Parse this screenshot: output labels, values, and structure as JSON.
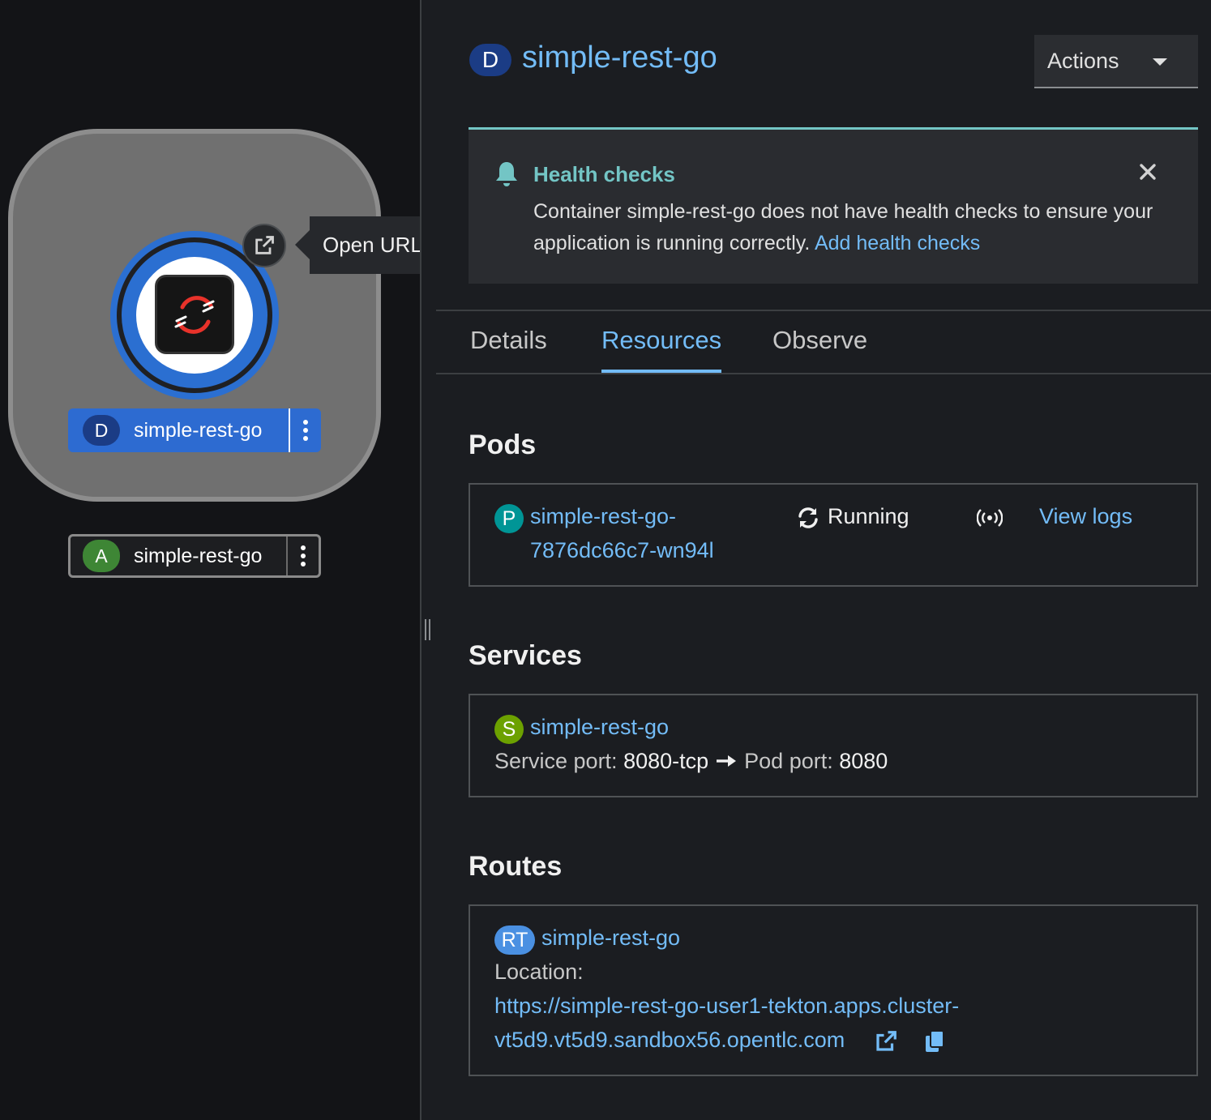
{
  "topology": {
    "tooltip": "Open URL",
    "deployment_label": {
      "badge": "D",
      "name": "simple-rest-go"
    },
    "application_label": {
      "badge": "A",
      "name": "simple-rest-go"
    }
  },
  "panel": {
    "title_badge": "D",
    "title": "simple-rest-go",
    "actions_label": "Actions",
    "alert": {
      "title": "Health checks",
      "message": "Container simple-rest-go does not have health checks to ensure your application is running correctly.",
      "link": "Add health checks"
    },
    "tabs": [
      {
        "label": "Details",
        "active": false
      },
      {
        "label": "Resources",
        "active": true
      },
      {
        "label": "Observe",
        "active": false
      }
    ],
    "pods": {
      "title": "Pods",
      "badge": "P",
      "name_line1": "simple-rest-go-",
      "name_line2": "7876dc66c7-wn94l",
      "status": "Running",
      "view_logs": "View logs"
    },
    "services": {
      "title": "Services",
      "badge": "S",
      "name": "simple-rest-go",
      "service_port_label": "Service port:",
      "service_port": "8080-tcp",
      "pod_port_label": "Pod port:",
      "pod_port": "8080"
    },
    "routes": {
      "title": "Routes",
      "badge": "RT",
      "name": "simple-rest-go",
      "location_label": "Location:",
      "url_line1": "https://simple-rest-go-user1-tekton.apps.cluster-",
      "url_line2": "vt5d9.vt5d9.sandbox56.opentlc.com"
    }
  },
  "colors": {
    "link": "#73bcf7",
    "deployment_badge": "#1b3c85",
    "application_badge": "#3e8635",
    "pod_badge": "#009596",
    "service_badge": "#6ca100",
    "route_badge": "#4a90e2",
    "alert_accent": "#73c5c5",
    "node_ring": "#2b6fd1"
  },
  "icons": [
    "external-link-icon",
    "bell-icon",
    "close-icon",
    "sync-icon",
    "signal-icon",
    "copy-icon",
    "caret-down-icon",
    "kebab-icon",
    "openshift-logo"
  ]
}
